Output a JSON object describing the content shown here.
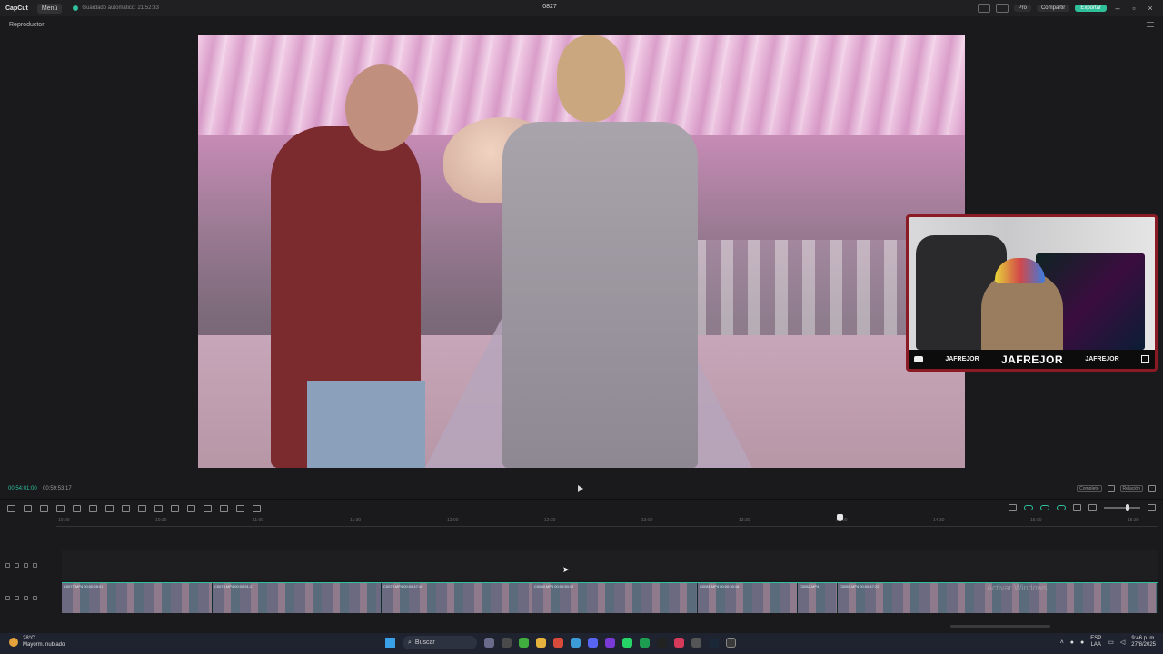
{
  "titlebar": {
    "app_logo": "CapCut",
    "menu_label": "Menú",
    "autosave_text": "Guardado automático: 21:52:33",
    "project_name": "0827",
    "pro_label": "Pro",
    "share_label": "Compartir",
    "export_label": "Exportar",
    "accent_color": "#2fbf9b"
  },
  "player": {
    "title": "Reproductor",
    "time_current": "00:54:01:00",
    "time_total": "00:59:53:17",
    "full_label": "Completo",
    "ratio_label": "Relación"
  },
  "webcam": {
    "name_left": "JAFREJOR",
    "name_center": "JAFREJOR",
    "name_right": "JAFREJOR",
    "frame_color": "#8a1a23"
  },
  "timeline": {
    "ruler_ticks": [
      "10:00",
      "10:30",
      "11:00",
      "11:30",
      "12:00",
      "12:30",
      "13:00",
      "13:30",
      "14:00",
      "14:30",
      "15:00",
      "15:30"
    ],
    "clips": [
      {
        "label": "C0077.MP4   00:00:28:01"
      },
      {
        "label": "C0078.MP4   00:00:51:17"
      },
      {
        "label": "C0079.MP4   00:00:47:10"
      },
      {
        "label": "C0080.MP4   00:00:50:17"
      },
      {
        "label": "C0081.MP4   00:00:30:16"
      },
      {
        "label": "C0082.MP4"
      },
      {
        "label": "C0083.MP4   00:00:47:22"
      }
    ],
    "watermark": "Activar Windows"
  },
  "taskbar": {
    "temperature": "28°C",
    "weather_text": "Mayorm. nublado",
    "search_label": "Buscar",
    "lang_top": "ESP",
    "lang_bottom": "LAA",
    "time": "9:46 p. m.",
    "date": "27/8/2025"
  }
}
